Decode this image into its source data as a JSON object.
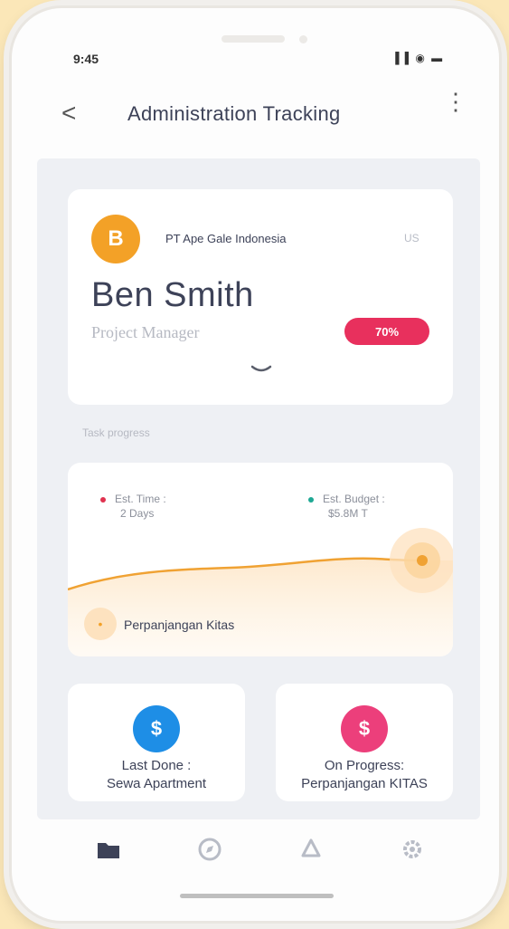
{
  "status_bar": {
    "time": "9:45",
    "icons": "▐▐ ◉ ▬"
  },
  "header": {
    "back_icon": "<",
    "title": "Administration Tracking",
    "more_icon": "⋮"
  },
  "profile": {
    "company_logo_letter": "B",
    "company_name": "PT Ape Gale Indonesia",
    "company_code": "US",
    "name": "Ben Smith",
    "role": "Project Manager",
    "progress": "70%",
    "progress_value": 0.7
  },
  "section": {
    "label": "Task progress"
  },
  "chart": {
    "est_time_label": "Est. Time :",
    "est_time_value": "2 Days",
    "est_budget_label": "Est. Budget :",
    "est_budget_value": "$5.8M T",
    "task_label": "Perpanjangan Kitas"
  },
  "cards": {
    "last_done_line1": "Last Done :",
    "last_done_line2": "Sewa Apartment",
    "on_progress_line1": "On Progress:",
    "on_progress_line2": "Perpanjangan KITAS",
    "money_symbol": "$"
  },
  "nav": {
    "items": [
      "folder-icon",
      "compass-icon",
      "bell-icon",
      "settings-icon"
    ]
  },
  "colors": {
    "accent_orange": "#f3a127",
    "badge_red": "#e8305d",
    "blue": "#1e8ee6",
    "pink": "#ec3f7b",
    "dot_time": "#e0324f",
    "dot_budget": "#1ea894"
  }
}
